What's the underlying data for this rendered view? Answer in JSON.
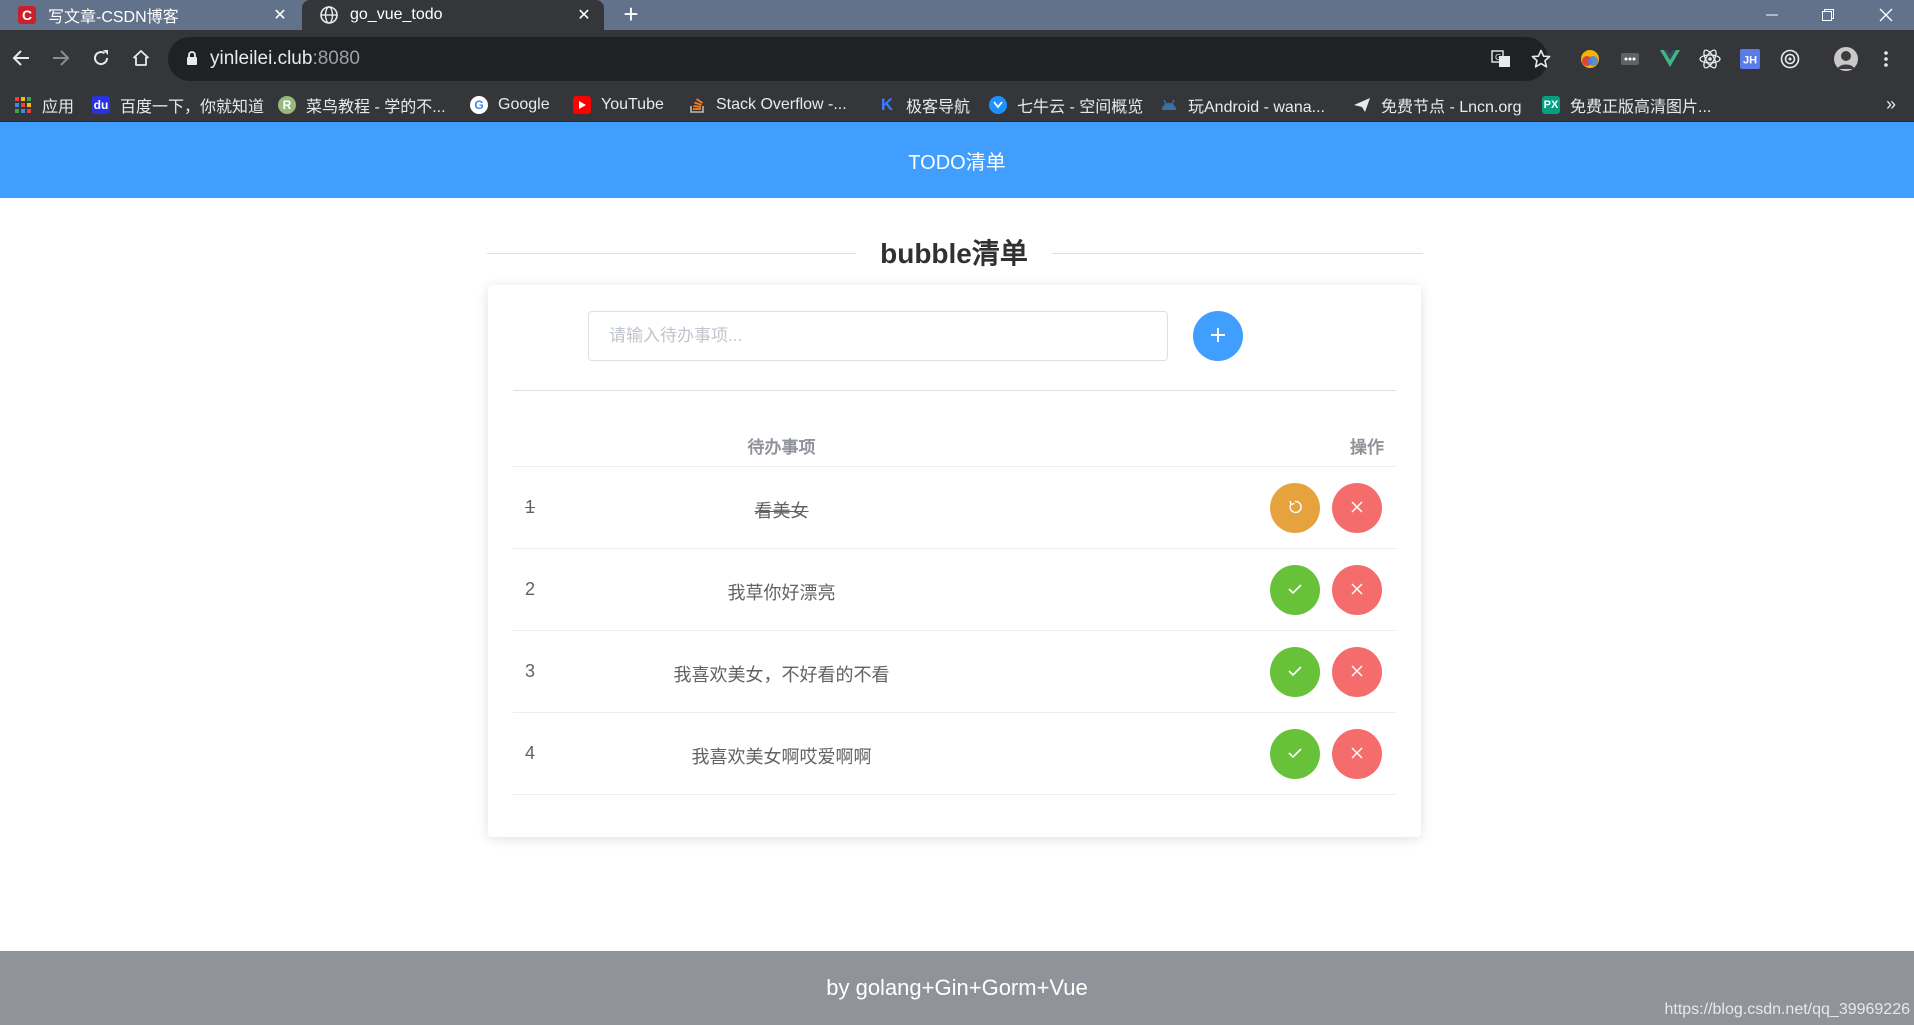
{
  "browser": {
    "tabs": [
      {
        "title": "写文章-CSDN博客",
        "favicon": "csdn-logo",
        "active": false
      },
      {
        "title": "go_vue_todo",
        "favicon": "globe-icon",
        "active": true
      }
    ],
    "new_tab": "+",
    "url": {
      "host": "yinleilei.club",
      "port": ":8080"
    },
    "bookmarks": [
      {
        "label": "应用",
        "icon": "apps-grid-icon"
      },
      {
        "label": "百度一下，你就知道",
        "icon": "baidu-icon"
      },
      {
        "label": "菜鸟教程 - 学的不...",
        "icon": "runoob-icon"
      },
      {
        "label": "Google",
        "icon": "google-icon"
      },
      {
        "label": "YouTube",
        "icon": "youtube-icon"
      },
      {
        "label": "Stack Overflow -...",
        "icon": "stackoverflow-icon"
      },
      {
        "label": "极客导航",
        "icon": "jike-icon"
      },
      {
        "label": "七牛云 - 空间概览",
        "icon": "qiniu-icon"
      },
      {
        "label": "玩Android - wana...",
        "icon": "android-icon"
      },
      {
        "label": "免费节点 - Lncn.org",
        "icon": "paper-plane-icon"
      },
      {
        "label": "免费正版高清图片...",
        "icon": "pexels-icon"
      }
    ],
    "bookmarks_more": "»"
  },
  "header": {
    "title": "TODO清单"
  },
  "card": {
    "title": "bubble清单",
    "input_placeholder": "请输入待办事项...",
    "input_value": "",
    "add_icon": "plus-icon",
    "columns": {
      "item": "待办事项",
      "action": "操作"
    },
    "todos": [
      {
        "index": "1",
        "text": "看美女",
        "done": true
      },
      {
        "index": "2",
        "text": "我草你好漂亮",
        "done": false
      },
      {
        "index": "3",
        "text": "我喜欢美女，不好看的不看",
        "done": false
      },
      {
        "index": "4",
        "text": "我喜欢美女啊哎爱啊啊",
        "done": false
      }
    ]
  },
  "footer": {
    "text": "by golang+Gin+Gorm+Vue"
  },
  "watermark": "https://blog.csdn.net/qq_39969226",
  "colors": {
    "primary": "#409eff",
    "success": "#67c23a",
    "warning": "#e6a23c",
    "danger": "#f56c6c",
    "footer": "#909399"
  }
}
